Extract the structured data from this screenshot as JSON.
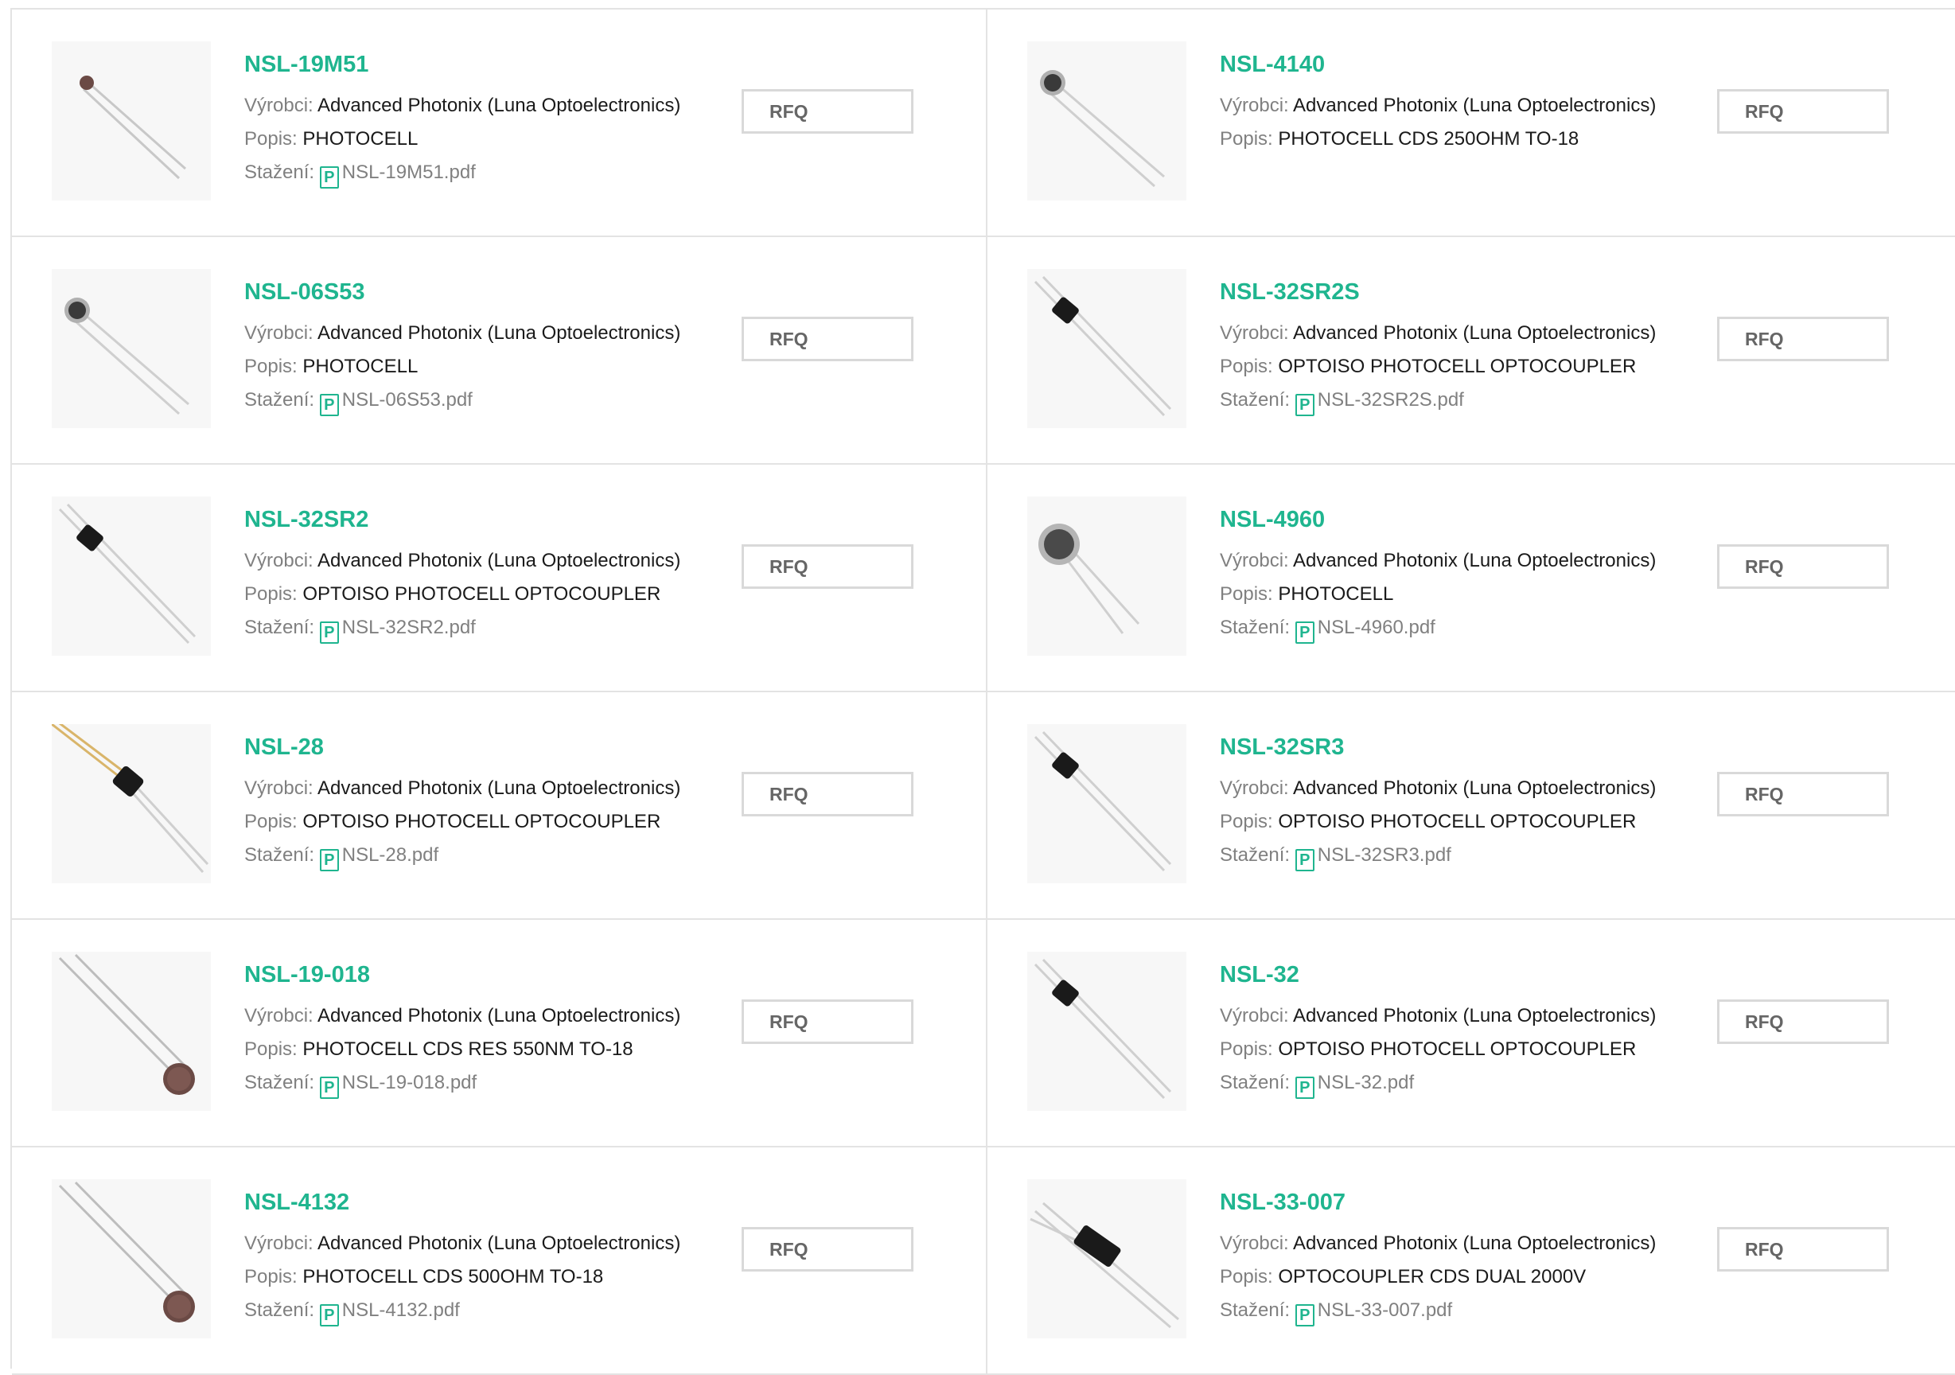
{
  "labels": {
    "manufacturer": "Výrobci:",
    "description": "Popis:",
    "download": "Stažení:",
    "rfq": "RFQ",
    "pdf_icon": "pdf-document-icon"
  },
  "colors": {
    "accent": "#1fb58f",
    "label_gray": "#808080",
    "border": "#e3e3e3"
  },
  "products": [
    {
      "name": "NSL-19M51",
      "manufacturer": "Advanced Photonix (Luna Optoelectronics)",
      "description": "PHOTOCELL",
      "download": "NSL-19M51.pdf",
      "image": "photocell-small-brown"
    },
    {
      "name": "NSL-4140",
      "manufacturer": "Advanced Photonix (Luna Optoelectronics)",
      "description": "PHOTOCELL CDS 250OHM TO-18",
      "download": "",
      "image": "photocell-metal-can"
    },
    {
      "name": "NSL-06S53",
      "manufacturer": "Advanced Photonix (Luna Optoelectronics)",
      "description": "PHOTOCELL",
      "download": "NSL-06S53.pdf",
      "image": "photocell-metal-can"
    },
    {
      "name": "NSL-32SR2S",
      "manufacturer": "Advanced Photonix (Luna Optoelectronics)",
      "description": "OPTOISO PHOTOCELL OPTOCOUPLER",
      "download": "NSL-32SR2S.pdf",
      "image": "optocoupler-black"
    },
    {
      "name": "NSL-32SR2",
      "manufacturer": "Advanced Photonix (Luna Optoelectronics)",
      "description": "OPTOISO PHOTOCELL OPTOCOUPLER",
      "download": "NSL-32SR2.pdf",
      "image": "optocoupler-black"
    },
    {
      "name": "NSL-4960",
      "manufacturer": "Advanced Photonix (Luna Optoelectronics)",
      "description": "PHOTOCELL",
      "download": "NSL-4960.pdf",
      "image": "photocell-large-can"
    },
    {
      "name": "NSL-28",
      "manufacturer": "Advanced Photonix (Luna Optoelectronics)",
      "description": "OPTOISO PHOTOCELL OPTOCOUPLER",
      "download": "NSL-28.pdf",
      "image": "optocoupler-gold-leads"
    },
    {
      "name": "NSL-32SR3",
      "manufacturer": "Advanced Photonix (Luna Optoelectronics)",
      "description": "OPTOISO PHOTOCELL OPTOCOUPLER",
      "download": "NSL-32SR3.pdf",
      "image": "optocoupler-black"
    },
    {
      "name": "NSL-19-018",
      "manufacturer": "Advanced Photonix (Luna Optoelectronics)",
      "description": "PHOTOCELL CDS RES 550NM TO-18",
      "download": "NSL-19-018.pdf",
      "image": "photocell-long-leads"
    },
    {
      "name": "NSL-32",
      "manufacturer": "Advanced Photonix (Luna Optoelectronics)",
      "description": "OPTOISO PHOTOCELL OPTOCOUPLER",
      "download": "NSL-32.pdf",
      "image": "optocoupler-black"
    },
    {
      "name": "NSL-4132",
      "manufacturer": "Advanced Photonix (Luna Optoelectronics)",
      "description": "PHOTOCELL CDS 500OHM TO-18",
      "download": "NSL-4132.pdf",
      "image": "photocell-long-leads"
    },
    {
      "name": "NSL-33-007",
      "manufacturer": "Advanced Photonix (Luna Optoelectronics)",
      "description": "OPTOCOUPLER CDS DUAL 2000V",
      "download": "NSL-33-007.pdf",
      "image": "optocoupler-dual"
    }
  ]
}
